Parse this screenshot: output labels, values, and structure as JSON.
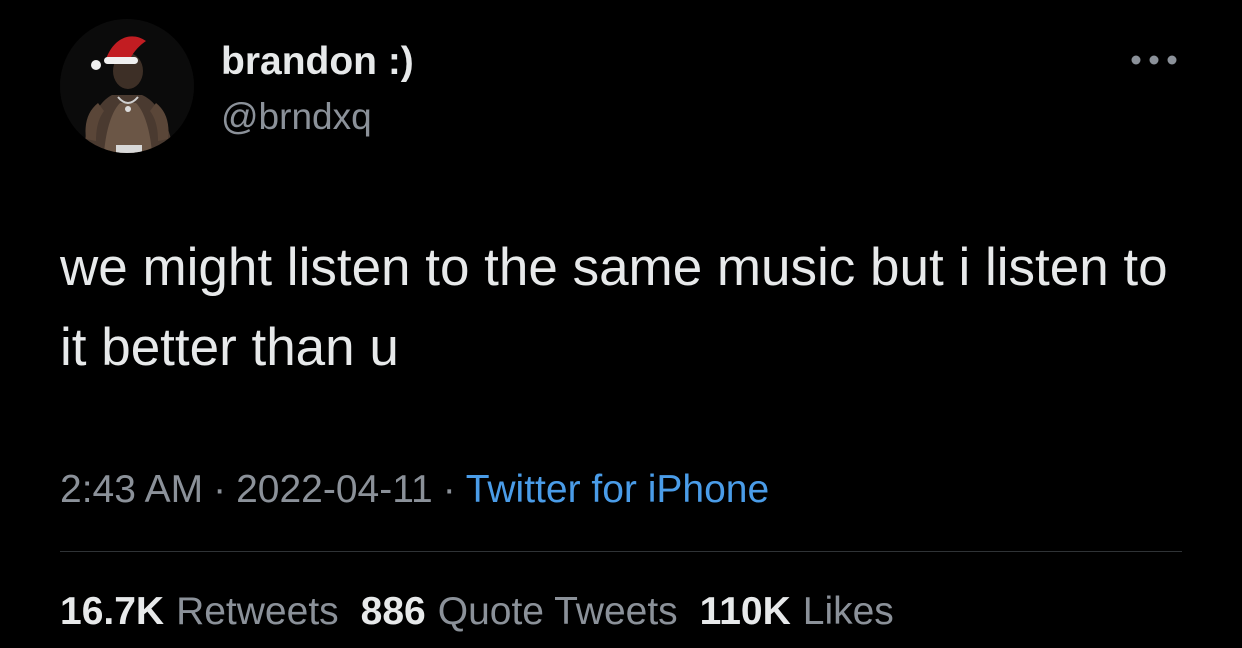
{
  "author": {
    "display_name": "brandon :)",
    "handle": "@brndxq",
    "avatar_icon": "user-avatar"
  },
  "menu": {
    "more_icon": "more-horizontal-icon"
  },
  "tweet": {
    "text": "we might listen to the same music but i listen to it better than u",
    "time": "2:43 AM",
    "date": "2022-04-11",
    "separator": "·",
    "source": "Twitter for iPhone"
  },
  "stats": {
    "retweets": {
      "count": "16.7K",
      "label": "Retweets"
    },
    "quote_tweets": {
      "count": "886",
      "label": "Quote Tweets"
    },
    "likes": {
      "count": "110K",
      "label": "Likes"
    }
  },
  "colors": {
    "background": "#000000",
    "primary_text": "#e7e9ea",
    "secondary_text": "#8b9199",
    "link": "#4a9ce8",
    "divider": "#2f3336"
  }
}
